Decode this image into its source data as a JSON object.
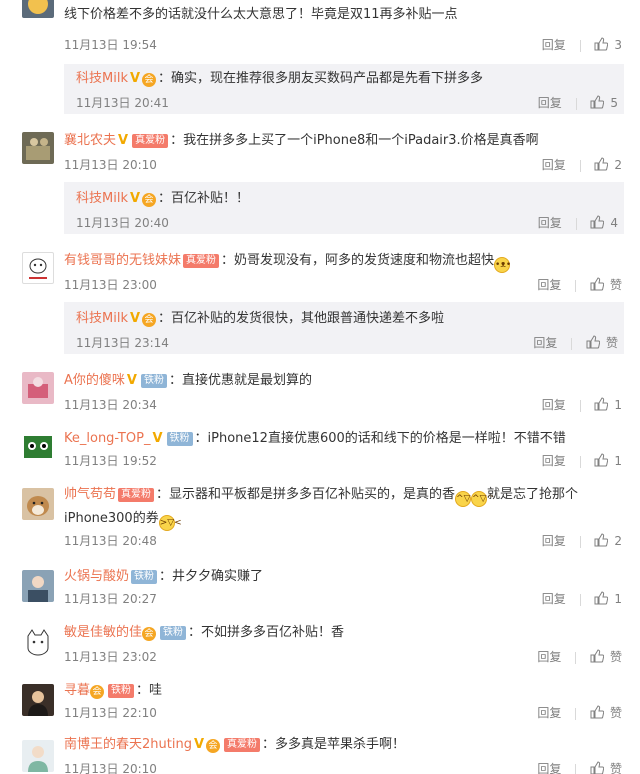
{
  "labels": {
    "reply": "回复",
    "like_word": "赞"
  },
  "top_cut": {
    "line1": "线下价格差不多的话就没什么太大意思了！毕竟是双11再多补贴一点",
    "time": "11月13日 19:54",
    "likes": "3"
  },
  "sub1": {
    "name": "科技Milk",
    "text": "确实，现在推荐很多朋友买数码产品都是先看下拼多多",
    "time": "11月13日 20:41",
    "likes": "5"
  },
  "c1": {
    "name": "襄北农夫",
    "fan": "真爱粉",
    "text": "我在拼多多上买了一个iPhone8和一个iPadair3.价格是真香啊",
    "time": "11月13日 20:10",
    "likes": "2"
  },
  "sub2": {
    "name": "科技Milk",
    "text": "百亿补贴！！",
    "time": "11月13日 20:40",
    "likes": "4"
  },
  "c2": {
    "name": "有钱哥哥的无钱妹妹",
    "fan": "真爱粉",
    "text": "奶哥发现没有，阿多的发货速度和物流也超快",
    "time": "11月13日 23:00"
  },
  "sub3": {
    "name": "科技Milk",
    "text": "百亿补贴的发货很快，其他跟普通快递差不多啦",
    "time": "11月13日 23:14"
  },
  "c3": {
    "name": "A你的傻咪",
    "fan": "铁粉",
    "text": "直接优惠就是最划算的",
    "time": "11月13日 20:34",
    "likes": "1"
  },
  "c4": {
    "name": "Ke_long-TOP_",
    "fan": "铁粉",
    "text": "iPhone12直接优惠600的话和线下的价格是一样啦！不错不错",
    "time": "11月13日 19:52",
    "likes": "1"
  },
  "c5": {
    "name": "帅气苟苟",
    "fan": "真爱粉",
    "text1": "显示器和平板都是拼多多百亿补贴买的，是真的香",
    "text1b": "就是忘了抢那个",
    "text2": "iPhone300的券",
    "time": "11月13日 20:48",
    "likes": "2"
  },
  "c6": {
    "name": "火锅与酸奶",
    "fan": "铁粉",
    "text": "井夕夕确实赚了",
    "time": "11月13日 20:27",
    "likes": "1"
  },
  "c7": {
    "name": "敏是佳敏的佳",
    "fan": "铁粉",
    "text": "不如拼多多百亿补贴！香",
    "time": "11月13日 23:02"
  },
  "c8": {
    "name": "寻暮",
    "fan": "铁粉",
    "text": "哇",
    "time": "11月13日 22:10"
  },
  "c9": {
    "name": "南博王的春天2huting",
    "fan": "真爱粉",
    "text": "多多真是苹果杀手啊！",
    "time": "11月13日 20:10"
  },
  "colors": {
    "name": "#eb7350",
    "gray": "#808080",
    "subBg": "#f2f2f5"
  }
}
